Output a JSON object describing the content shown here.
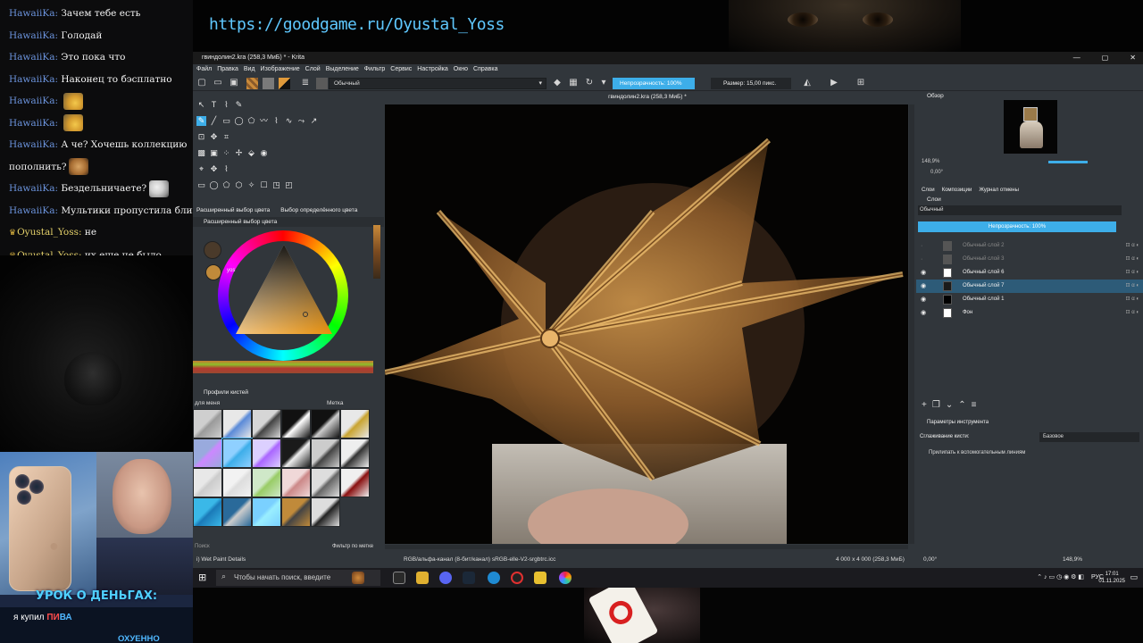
{
  "stream": {
    "url": "https://goodgame.ru/Oyustal_Yoss",
    "chat": [
      {
        "user": "HawaiiKa:",
        "text": "Зачем тебе есть",
        "emote": "",
        "mine": false
      },
      {
        "user": "HawaiiKa:",
        "text": "Голодай",
        "emote": "",
        "mine": false
      },
      {
        "user": "HawaiiKa:",
        "text": "Это пока что",
        "emote": "",
        "mine": false
      },
      {
        "user": "HawaiiKa:",
        "text": "Наконец то бэсплатно",
        "emote": "",
        "mine": false
      },
      {
        "user": "HawaiiKa:",
        "text": "",
        "emote": "hand",
        "mine": false
      },
      {
        "user": "HawaiiKa:",
        "text": "",
        "emote": "hand",
        "mine": false
      },
      {
        "user": "HawaiiKa:",
        "text": "А че? Хочешь коллекцию",
        "emote": "",
        "mine": false
      },
      {
        "user": "",
        "text": "пополнить?",
        "emote": "doge",
        "mine": false
      },
      {
        "user": "HawaiiKa:",
        "text": "Бездельничаете?",
        "emote": "cat",
        "mine": false
      },
      {
        "user": "HawaiiKa:",
        "text": "Мультики пропустила блин",
        "emote": "face",
        "mine": false
      },
      {
        "user": "Oyustal_Yoss:",
        "text": "не",
        "emote": "",
        "mine": true
      },
      {
        "user": "Oyustal_Yoss:",
        "text": "их еще не было",
        "emote": "",
        "mine": true
      }
    ],
    "ad": {
      "title": "УРОК О ДЕНЬГАХ:",
      "line_prefix": "я купил",
      "line_red": "ПИ",
      "line_blue": "ВА",
      "footer": "ОХУЕННО"
    }
  },
  "krita": {
    "title": "гвиндолин2.kra (258,3 МиБ) * - Krita",
    "window_controls": [
      "—",
      "▢",
      "✕"
    ],
    "menu": [
      "Файл",
      "Правка",
      "Вид",
      "Изображение",
      "Слой",
      "Выделение",
      "Фильтр",
      "Сервис",
      "Настройка",
      "Окно",
      "Справка"
    ],
    "toolbar": {
      "brush_preset": "Обычный",
      "opacity_label": "Непрозрачность: 100%",
      "size_label": "Размер: 15,00 пикс."
    },
    "canvas_tab": "гвиндолин2.kra (258,3 МиБ) *",
    "color_selector": {
      "tab_advanced": "Расширенный выбор цвета",
      "tab_specific": "Выбор определённого цвета",
      "header": "Расширенный выбор цвета",
      "history_label": "yos"
    },
    "brush_presets": {
      "header": "Профили кистей",
      "tag": "для меня",
      "tag_label": "Метка",
      "search_placeholder": "Поиск",
      "filter_label": "Фильтр по метке",
      "current_brush": "i) Wet Paint Details"
    },
    "overview": {
      "header": "Обзор",
      "zoom": "148,9%",
      "rotation": "0,00°"
    },
    "layers": {
      "tabs": [
        "Слои",
        "Композиции",
        "Журнал отмены"
      ],
      "header": "Слои",
      "blend_mode": "Обычный",
      "opacity": "Непрозрачность: 100%",
      "items": [
        {
          "name": "Обычный слой 2",
          "visible": false,
          "selected": false,
          "thumb": "#555555"
        },
        {
          "name": "Обычный слой 3",
          "visible": false,
          "selected": false,
          "thumb": "#555555"
        },
        {
          "name": "Обычный слой 6",
          "visible": true,
          "selected": false,
          "thumb": "#ffffff"
        },
        {
          "name": "Обычный слой 7",
          "visible": true,
          "selected": true,
          "thumb": "#1a1a1a"
        },
        {
          "name": "Обычный слой 1",
          "visible": true,
          "selected": false,
          "thumb": "#000000"
        },
        {
          "name": "Фон",
          "visible": true,
          "selected": false,
          "thumb": "#ffffff"
        }
      ]
    },
    "tool_options": {
      "header": "Параметры инструмента",
      "smoothing_label": "Сглаживание кисти:",
      "smoothing_value": "Базовое",
      "snap_label": "Прилипать к вспомогательным линиям"
    },
    "status": {
      "brush": "i) Wet Paint Details",
      "color_space": "RGB/альфа-канал (8-бит/канал)  sRGB-elle-V2-srgbtrc.icc",
      "dimensions": "4 000 x 4 000 (258,3 МиБ)",
      "rotation": "0,00°",
      "zoom": "148,9%"
    },
    "taskbar": {
      "search_placeholder": "Чтобы начать поиск, введите",
      "lang": "РУС",
      "time": "17:01",
      "date": "01.11.2025"
    }
  }
}
